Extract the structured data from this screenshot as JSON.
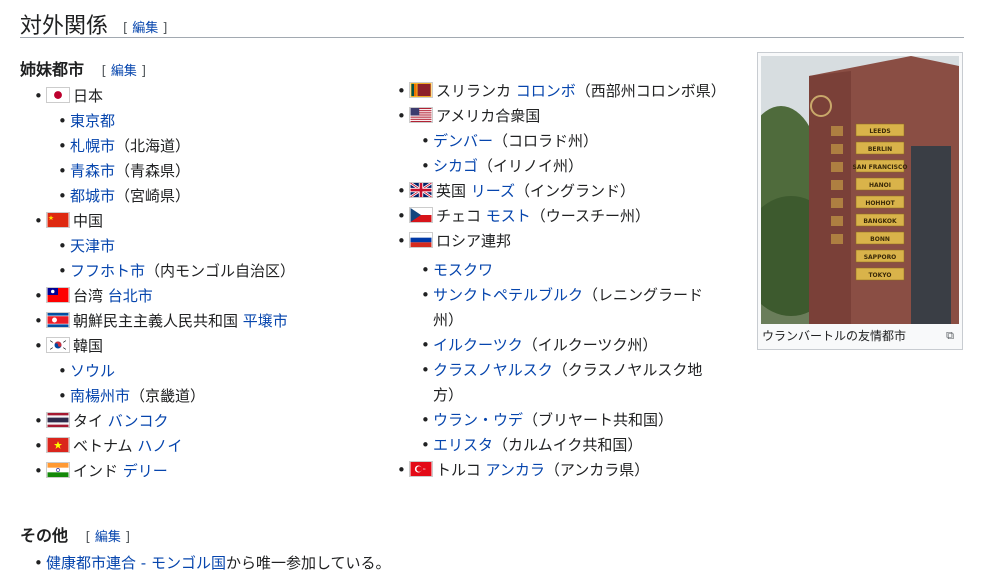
{
  "section": {
    "title": "対外関係",
    "edit_open": "[ ",
    "edit_label": "編集",
    "edit_close": " ]"
  },
  "sister": {
    "title": "姉妹都市",
    "edit_label": "編集"
  },
  "other": {
    "title": "その他",
    "edit_label": "編集"
  },
  "col1": {
    "japan": "日本",
    "tokyo": "東京都",
    "sapporo": "札幌市",
    "sapporo_note": "（北海道）",
    "aomori": "青森市",
    "aomori_note": "（青森県）",
    "miyakonojo": "都城市",
    "miyakonojo_note": "（宮崎県）",
    "china": "中国",
    "tianjin": "天津市",
    "hohhot": "フフホト市",
    "hohhot_note": "（内モンゴル自治区）",
    "taiwan": "台湾 ",
    "taipei": "台北市",
    "nkorea": "朝鮮民主主義人民共和国 ",
    "pyongyang": "平壌市",
    "skorea": "韓国",
    "seoul": "ソウル",
    "namyangju": "南楊州市",
    "namyangju_note": "（京畿道）",
    "thai": "タイ ",
    "bangkok": "バンコク",
    "vietnam": "ベトナム ",
    "hanoi": "ハノイ",
    "india": "インド ",
    "delhi": "デリー"
  },
  "col2": {
    "srilanka": "スリランカ ",
    "colombo": "コロンボ",
    "colombo_note": "（西部州コロンボ県）",
    "usa": "アメリカ合衆国",
    "denver": "デンバー",
    "denver_note": "（コロラド州）",
    "chicago": "シカゴ",
    "chicago_note": "（イリノイ州）",
    "uk": "英国 ",
    "leeds": "リーズ",
    "leeds_note": "（イングランド）",
    "czech": "チェコ ",
    "most": "モスト",
    "most_note": "（ウースチー州）",
    "russia": "ロシア連邦",
    "moscow": "モスクワ",
    "stpete": "サンクトペテルブルク",
    "stpete_note_a": "（レニングラード",
    "stpete_note_b": "州）",
    "irkutsk": "イルクーツク",
    "irkutsk_note": "（イルクーツク州）",
    "krasnoyarsk": "クラスノヤルスク",
    "krasnoyarsk_note_a": "（クラスノヤルスク地",
    "krasnoyarsk_note_b": "方）",
    "ulanude": "ウラン・ウデ",
    "ulanude_note": "（ブリヤート共和国）",
    "elista": "エリスタ",
    "elista_note": "（カルムイク共和国）",
    "turkey": "トルコ ",
    "ankara": "アンカラ",
    "ankara_note": "（アンカラ県）"
  },
  "other_item": {
    "link1": "健康都市連合",
    "sep": " - ",
    "link2": "モンゴル国",
    "rest": "から唯一参加している。"
  },
  "thumb": {
    "caption": "ウランバートルの友情都市",
    "signs": [
      "LEEDS",
      "BERLIN",
      "SAN FRANCISCO",
      "HANOI",
      "HOHHOT",
      "BANGKOK",
      "BONN",
      "SAPPORO",
      "TOKYO"
    ]
  }
}
